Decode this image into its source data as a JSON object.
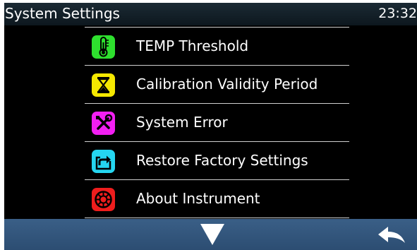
{
  "header": {
    "title": "System Settings",
    "time": "23:32"
  },
  "menu": {
    "items": [
      {
        "label": "TEMP Threshold",
        "icon": "thermometer-icon",
        "color": "#2ee02e"
      },
      {
        "label": "Calibration Validity Period",
        "icon": "hourglass-icon",
        "color": "#f5e800"
      },
      {
        "label": "System Error",
        "icon": "tools-icon",
        "color": "#f21ff2"
      },
      {
        "label": "Restore Factory Settings",
        "icon": "restore-icon",
        "color": "#25d6f0"
      },
      {
        "label": "About Instrument",
        "icon": "info-ring-icon",
        "color": "#ee1d1d"
      }
    ]
  },
  "footer": {
    "down_icon": "down-arrow-icon",
    "back_icon": "back-arrow-icon"
  },
  "colors": {
    "background": "#000000",
    "header": "#16232c",
    "footer": "#34577d",
    "text": "#ffffff",
    "divider": "#cfcfcf"
  }
}
